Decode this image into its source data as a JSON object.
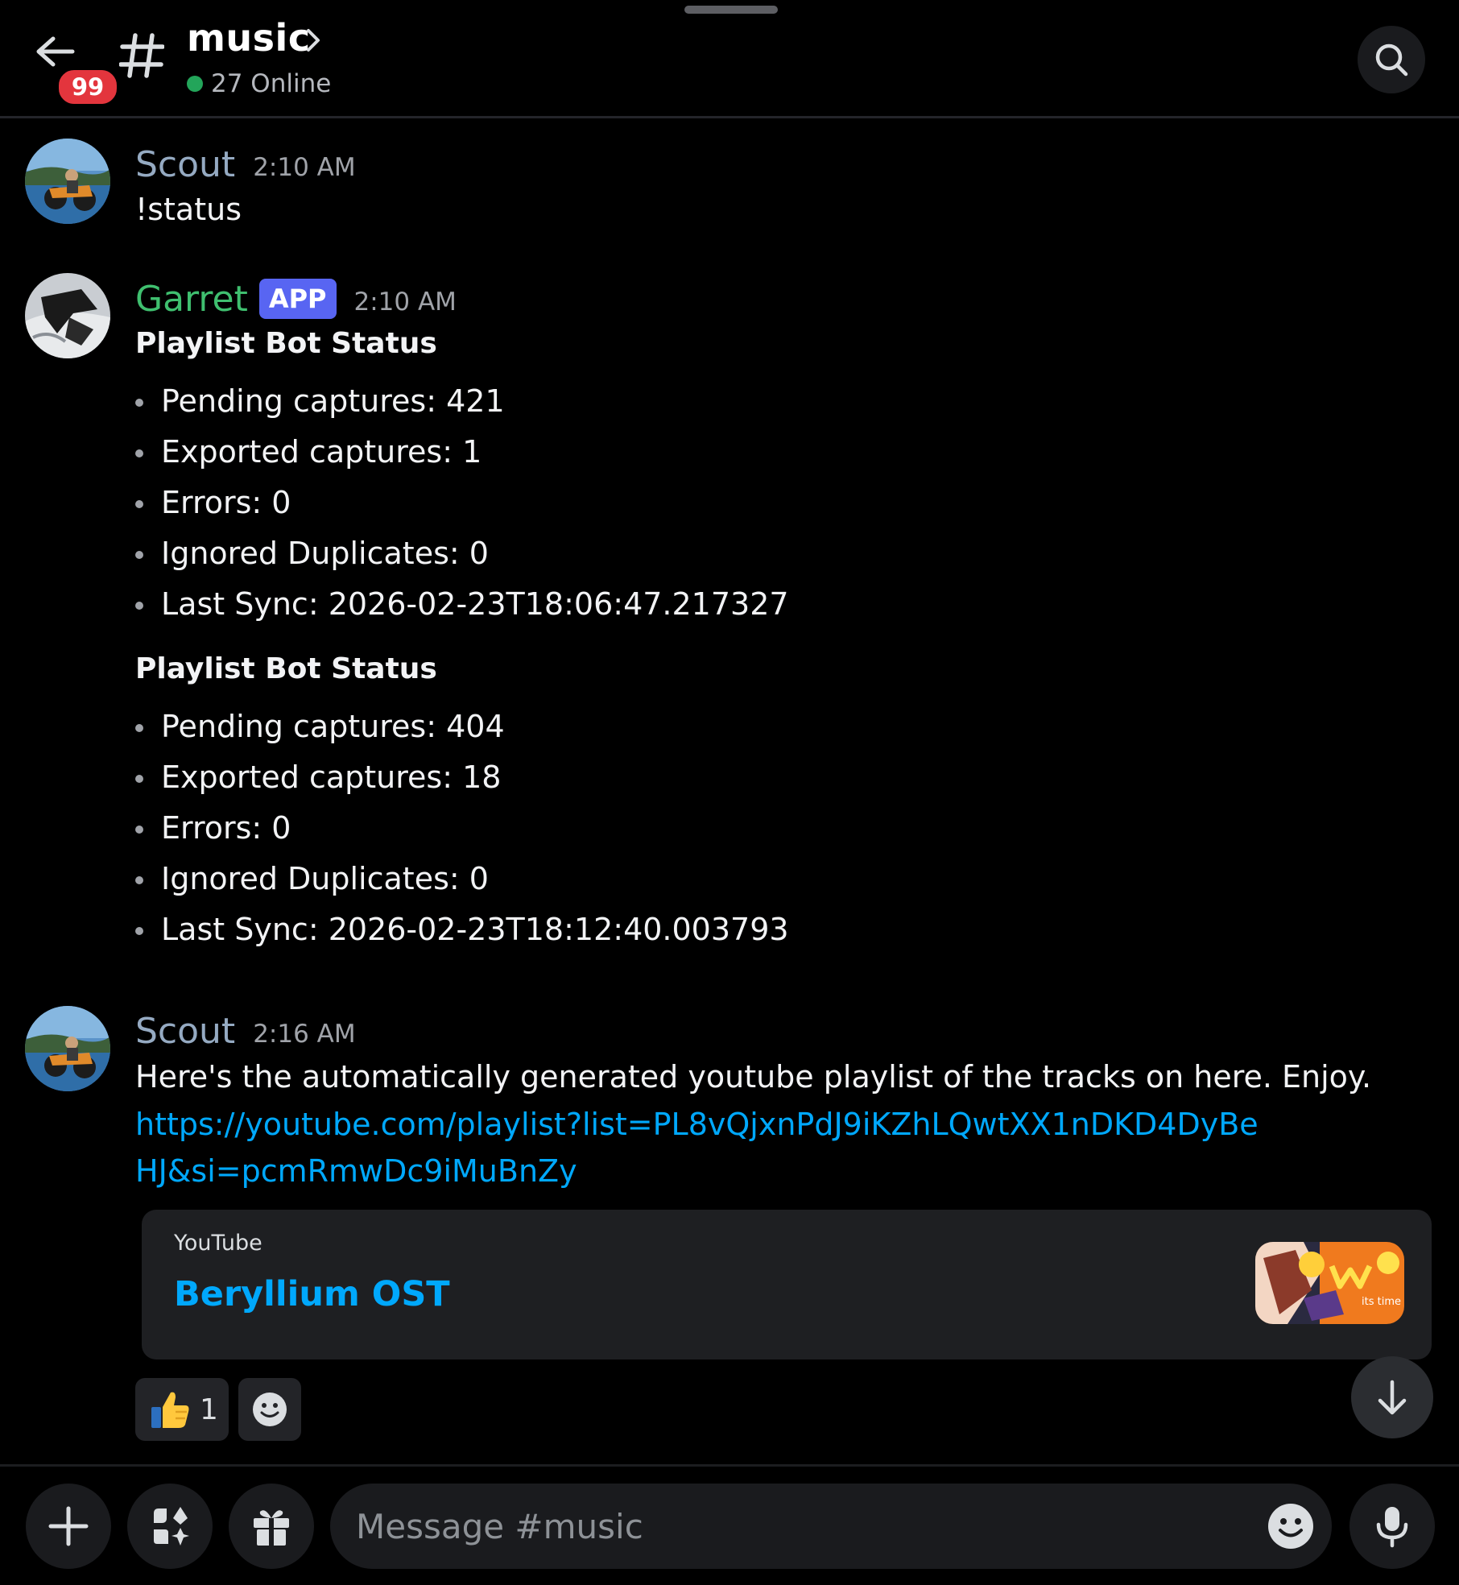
{
  "header": {
    "unread_badge": "99",
    "channel_name": "music",
    "online_text": "27 Online"
  },
  "messages": [
    {
      "author": "Scout",
      "timestamp": "2:10 AM",
      "text": "!status"
    },
    {
      "author": "Garret",
      "tag": "APP",
      "timestamp": "2:10 AM",
      "sections": [
        {
          "title": "Playlist Bot Status",
          "items": [
            "Pending captures: 421",
            "Exported captures: 1",
            "Errors: 0",
            "Ignored Duplicates: 0",
            "Last Sync: 2026-02-23T18:06:47.217327"
          ]
        },
        {
          "title": "Playlist Bot Status",
          "items": [
            "Pending captures: 404",
            "Exported captures: 18",
            "Errors: 0",
            "Ignored Duplicates: 0",
            "Last Sync: 2026-02-23T18:12:40.003793"
          ]
        }
      ]
    },
    {
      "author": "Scout",
      "timestamp": "2:16 AM",
      "text": "Here's the automatically generated youtube playlist of the tracks on here. Enjoy.",
      "link": "https://youtube.com/playlist?list=PL8vQjxnPdJ9iKZhLQwtXX1nDKD4DyBeHJ&si=pcmRmwDc9iMuBnZy",
      "embed": {
        "provider": "YouTube",
        "title": "Beryllium OST",
        "thumbnail_caption": "its time"
      },
      "reactions": [
        {
          "emoji": "thumbs-up",
          "count": "1"
        }
      ]
    }
  ],
  "composer": {
    "placeholder": "Message #music"
  },
  "colors": {
    "background": "#000000",
    "scout_name": "#95aac2",
    "garret_name": "#3fbf6f",
    "app_tag": "#5865f2",
    "link": "#00a8fc",
    "online": "#23a55a",
    "badge": "#e3353d"
  }
}
